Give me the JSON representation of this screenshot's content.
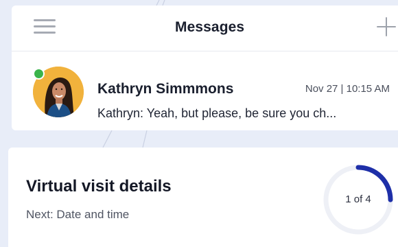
{
  "header": {
    "title": "Messages",
    "menu_icon": "hamburger-menu-icon",
    "add_icon": "plus-icon"
  },
  "conversation": {
    "sender": "Kathryn Simmmons",
    "timestamp": "Nov 27 | 10:15 AM",
    "preview": "Kathryn: Yeah, but please, be sure you ch...",
    "status": "online",
    "status_color": "#3ab44a",
    "avatar_bg": "#f1b23c"
  },
  "visit": {
    "title": "Virtual visit details",
    "subtitle": "Next: Date and time",
    "progress_label": "1 of 4",
    "progress": {
      "current": 1,
      "total": 4
    },
    "progress_color": "#1e2fa8",
    "track_color": "#eef0f6"
  }
}
